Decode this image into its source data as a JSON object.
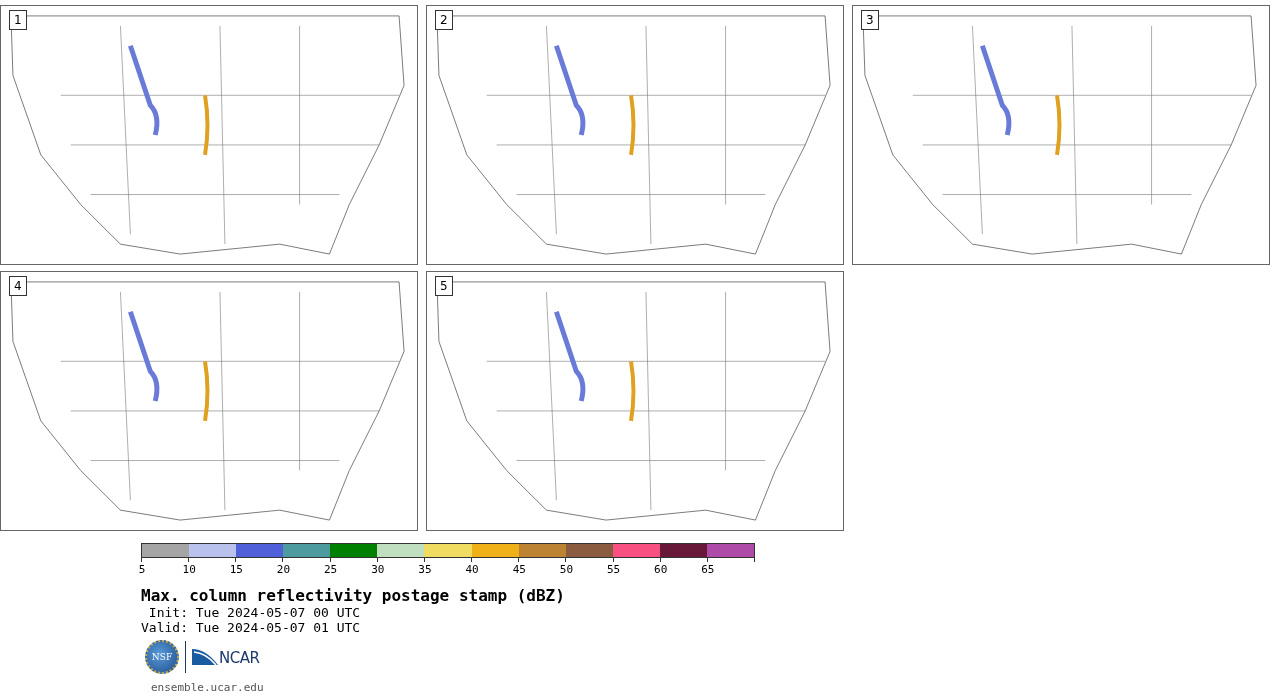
{
  "members": [
    {
      "label": "1"
    },
    {
      "label": "2"
    },
    {
      "label": "3"
    },
    {
      "label": "4"
    },
    {
      "label": "5"
    }
  ],
  "colorbar": {
    "bins": [
      {
        "color": "#a5a5a5",
        "tick": "5"
      },
      {
        "color": "#b8c2ec",
        "tick": "10"
      },
      {
        "color": "#5060d8",
        "tick": "15"
      },
      {
        "color": "#4d9a9f",
        "tick": "20"
      },
      {
        "color": "#008000",
        "tick": "25"
      },
      {
        "color": "#c0dfc0",
        "tick": "30"
      },
      {
        "color": "#f0dc60",
        "tick": "35"
      },
      {
        "color": "#f0b018",
        "tick": "40"
      },
      {
        "color": "#bc8432",
        "tick": "45"
      },
      {
        "color": "#8c5c40",
        "tick": "50"
      },
      {
        "color": "#f85080",
        "tick": "55"
      },
      {
        "color": "#681838",
        "tick": "60"
      },
      {
        "color": "#ae4aa8",
        "tick": "65"
      }
    ]
  },
  "title": "Max. column reflectivity postage stamp (dBZ)",
  "init": " Init: Tue 2024-05-07 00 UTC",
  "valid": "Valid: Tue 2024-05-07 01 UTC",
  "logos": {
    "nsf": "NSF",
    "ncar": "NCAR"
  },
  "url": "ensemble.ucar.edu"
}
